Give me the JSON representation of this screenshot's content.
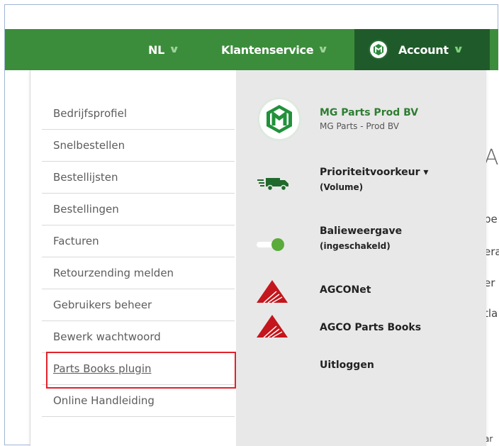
{
  "nav": {
    "lang_label": "NL",
    "service_label": "Klantenservice",
    "account_label": "Account"
  },
  "menu": {
    "items": [
      "Bedrijfsprofiel",
      "Snelbestellen",
      "Bestellijsten",
      "Bestellingen",
      "Facturen",
      "Retourzending melden",
      "Gebruikers beheer",
      "Bewerk wachtwoord",
      "Parts Books plugin",
      "Online Handleiding"
    ]
  },
  "panel": {
    "company_name": "MG Parts Prod BV",
    "company_sub": "MG Parts - Prod BV",
    "priority_label": "Prioriteitvoorkeur",
    "priority_value": "(Volume)",
    "counter_label": "Balieweergave",
    "counter_value": "(ingeschakeld)",
    "agconet_label": "AGCONet",
    "agco_parts_label": "AGCO Parts Books",
    "logout_label": "Uitloggen"
  },
  "background_text": {
    "heading_frag": "A",
    "line1": "pe",
    "line2": "era",
    "line3": "er",
    "line4": "tla",
    "bottom": "ar"
  },
  "colors": {
    "nav_green": "#3c8d3b",
    "account_dark_green": "#1f5b2a",
    "company_green": "#2f7d32",
    "highlight_red": "#e3212b",
    "agco_red": "#c4161c",
    "toggle_green": "#5aab3a"
  },
  "icons": {
    "chevron": "chevron-down-icon",
    "truck": "truck-icon",
    "toggle": "toggle-on-icon",
    "agco": "agco-logo-icon"
  }
}
